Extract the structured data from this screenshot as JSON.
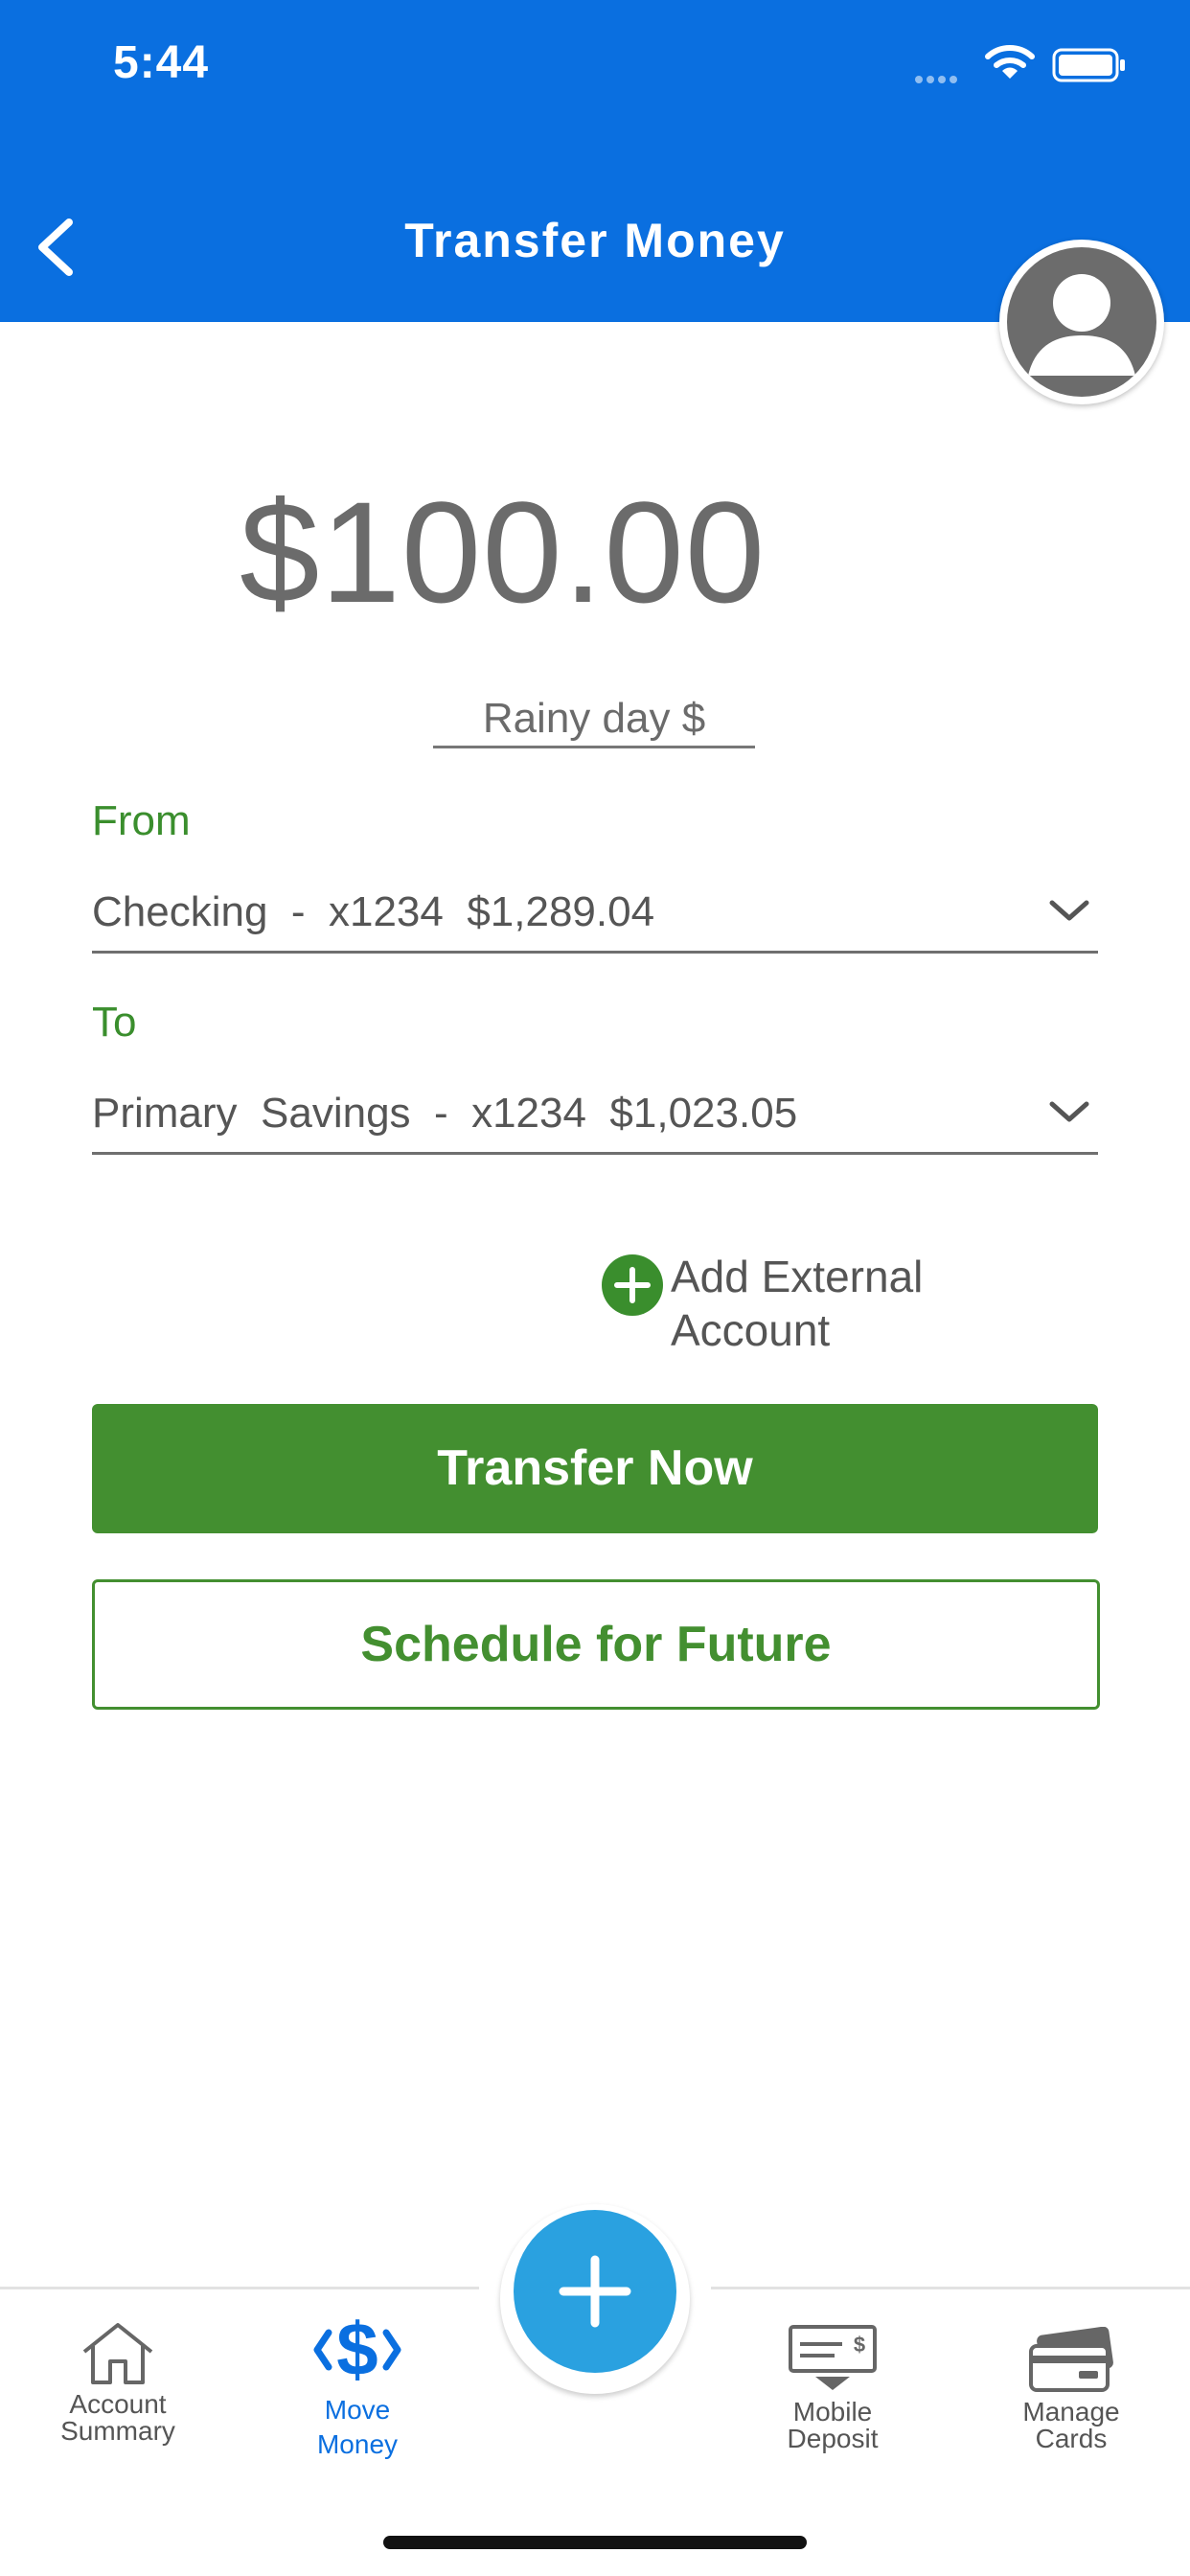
{
  "status_bar": {
    "time": "5:44"
  },
  "header": {
    "title": "Transfer Money"
  },
  "transfer": {
    "amount": "$100.00",
    "memo": "Rainy day $",
    "from_label": "From",
    "from_account": "Checking  -  x1234  $1,289.04",
    "to_label": "To",
    "to_account": "Primary  Savings  -  x1234  $1,023.05"
  },
  "add_external": {
    "line1": "Add External",
    "line2": "Account"
  },
  "buttons": {
    "transfer_now": "Transfer Now",
    "schedule_future": "Schedule for Future"
  },
  "tabs": [
    {
      "line1": "Account",
      "line2": "Summary",
      "icon": "house-icon",
      "active": false
    },
    {
      "line1": "Move",
      "line2": "Money",
      "icon": "dollar-icon",
      "active": true
    },
    {
      "line1": "Mobile",
      "line2": "Deposit",
      "icon": "check-deposit-icon",
      "active": false
    },
    {
      "line1": "Manage",
      "line2": "Cards",
      "icon": "card-icon",
      "active": false
    }
  ],
  "colors": {
    "header_blue": "#0a6fe0",
    "accent_green": "#438f30",
    "fab_blue": "#2aa1e0",
    "active_tab_blue": "#0a6fe0"
  }
}
